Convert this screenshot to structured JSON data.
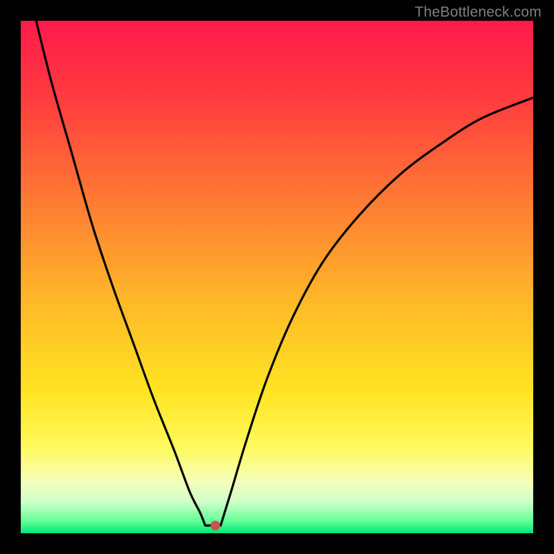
{
  "watermark": "TheBottleneck.com",
  "colors": {
    "frame_bg": "#000000",
    "watermark": "#808080",
    "curve": "#000000",
    "marker": "#c7554b",
    "gradient_stops": [
      {
        "offset": 0.0,
        "color": "#ff1a4b"
      },
      {
        "offset": 0.15,
        "color": "#ff3b3f"
      },
      {
        "offset": 0.35,
        "color": "#ff7a33"
      },
      {
        "offset": 0.55,
        "color": "#ffb928"
      },
      {
        "offset": 0.72,
        "color": "#ffe321"
      },
      {
        "offset": 0.83,
        "color": "#fff95a"
      },
      {
        "offset": 0.9,
        "color": "#f5ffbb"
      },
      {
        "offset": 0.94,
        "color": "#ceffc8"
      },
      {
        "offset": 0.975,
        "color": "#66ff99"
      },
      {
        "offset": 1.0,
        "color": "#00e676"
      }
    ]
  },
  "chart_data": {
    "type": "line",
    "title": "",
    "xlabel": "",
    "ylabel": "",
    "ylim": [
      0,
      100
    ],
    "xlim": [
      0,
      100
    ],
    "marker": {
      "x": 38,
      "y": 98.5
    },
    "left_curve": {
      "name": "left-branch",
      "points": [
        {
          "x": 3,
          "y": 0
        },
        {
          "x": 6,
          "y": 12
        },
        {
          "x": 10,
          "y": 26
        },
        {
          "x": 14,
          "y": 40
        },
        {
          "x": 18,
          "y": 52
        },
        {
          "x": 22,
          "y": 63
        },
        {
          "x": 26,
          "y": 74
        },
        {
          "x": 30,
          "y": 84
        },
        {
          "x": 33,
          "y": 92
        },
        {
          "x": 35,
          "y": 96
        },
        {
          "x": 36,
          "y": 98.5
        }
      ]
    },
    "flat_segment": {
      "name": "trough",
      "points": [
        {
          "x": 36,
          "y": 98.5
        },
        {
          "x": 39,
          "y": 98.5
        }
      ]
    },
    "right_curve": {
      "name": "right-branch",
      "points": [
        {
          "x": 39,
          "y": 98.5
        },
        {
          "x": 41,
          "y": 92
        },
        {
          "x": 44,
          "y": 82
        },
        {
          "x": 48,
          "y": 70
        },
        {
          "x": 53,
          "y": 58
        },
        {
          "x": 59,
          "y": 47
        },
        {
          "x": 66,
          "y": 38
        },
        {
          "x": 74,
          "y": 30
        },
        {
          "x": 82,
          "y": 24
        },
        {
          "x": 90,
          "y": 19
        },
        {
          "x": 100,
          "y": 15
        }
      ]
    }
  }
}
